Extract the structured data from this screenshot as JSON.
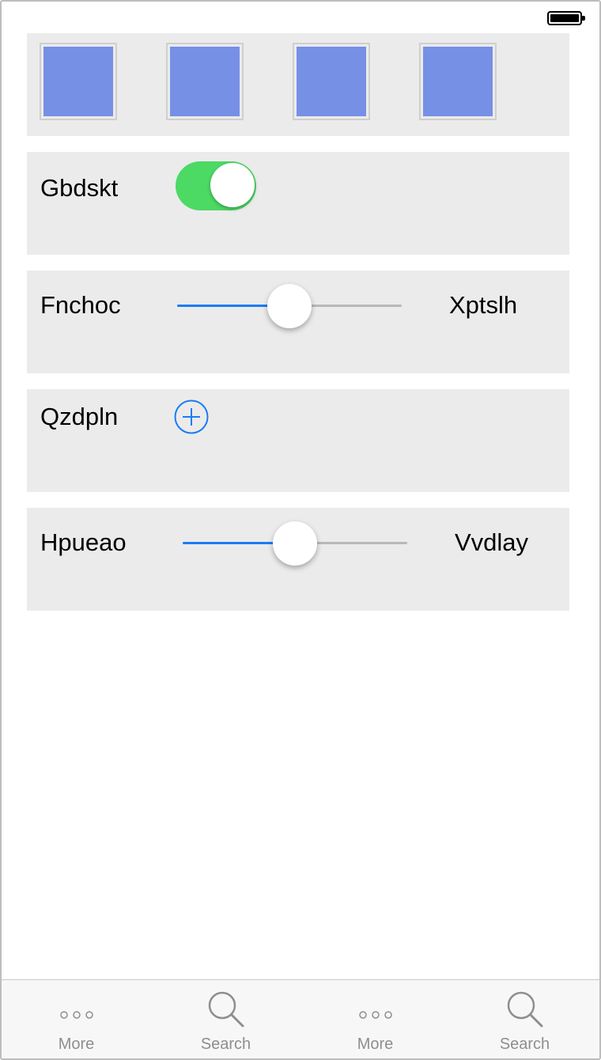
{
  "status_bar": {
    "battery_icon": "battery-full-icon",
    "battery_level": 1.0
  },
  "gallery": {
    "thumbnails": [
      {
        "color": "#7690e6"
      },
      {
        "color": "#7690e6"
      },
      {
        "color": "#7690e6"
      },
      {
        "color": "#7690e6"
      }
    ]
  },
  "rows": {
    "toggle_row": {
      "label": "Gbdskt",
      "on": true,
      "accent": "#4cd964"
    },
    "slider_row_1": {
      "label": "Fnchoc",
      "value_label": "Xptslh",
      "value": 0.5
    },
    "add_row": {
      "label": "Qzdpln",
      "icon": "plus-circle-icon"
    },
    "slider_row_2": {
      "label": "Hpueao",
      "value_label": "Vvdlay",
      "value": 0.5
    }
  },
  "colors": {
    "accent_blue": "#1a7cf5",
    "toggle_green": "#4cd964",
    "card_bg": "#ebebeb",
    "thumb_blue": "#7690e6"
  },
  "tab_bar": {
    "items": [
      {
        "label": "More",
        "icon": "more-icon"
      },
      {
        "label": "Search",
        "icon": "search-icon"
      },
      {
        "label": "More",
        "icon": "more-icon"
      },
      {
        "label": "Search",
        "icon": "search-icon"
      }
    ]
  }
}
